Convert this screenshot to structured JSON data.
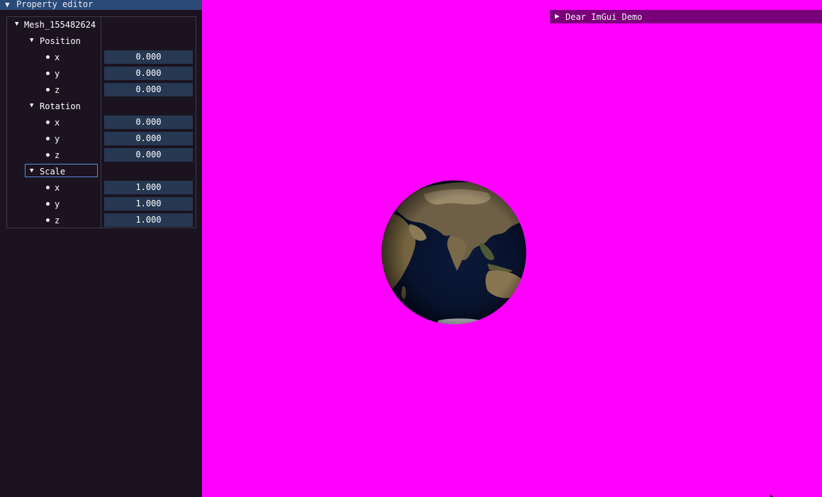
{
  "property_editor": {
    "title": "Property editor",
    "object_name": "Mesh_155482624",
    "groups": [
      {
        "label": "Position",
        "fields": [
          {
            "axis": "x",
            "value": "0.000"
          },
          {
            "axis": "y",
            "value": "0.000"
          },
          {
            "axis": "z",
            "value": "0.000"
          }
        ]
      },
      {
        "label": "Rotation",
        "fields": [
          {
            "axis": "x",
            "value": "0.000"
          },
          {
            "axis": "y",
            "value": "0.000"
          },
          {
            "axis": "z",
            "value": "0.000"
          }
        ]
      },
      {
        "label": "Scale",
        "fields": [
          {
            "axis": "x",
            "value": "1.000"
          },
          {
            "axis": "y",
            "value": "1.000"
          },
          {
            "axis": "z",
            "value": "1.000"
          }
        ]
      }
    ]
  },
  "demo_window": {
    "title": "Dear ImGui Demo"
  },
  "colors": {
    "viewport_bg": "#ff00ff",
    "panel_bg": "#1b1320",
    "title_bar": "#2a4a78",
    "field_bg": "#263852",
    "demo_bar": "#7a007a"
  }
}
